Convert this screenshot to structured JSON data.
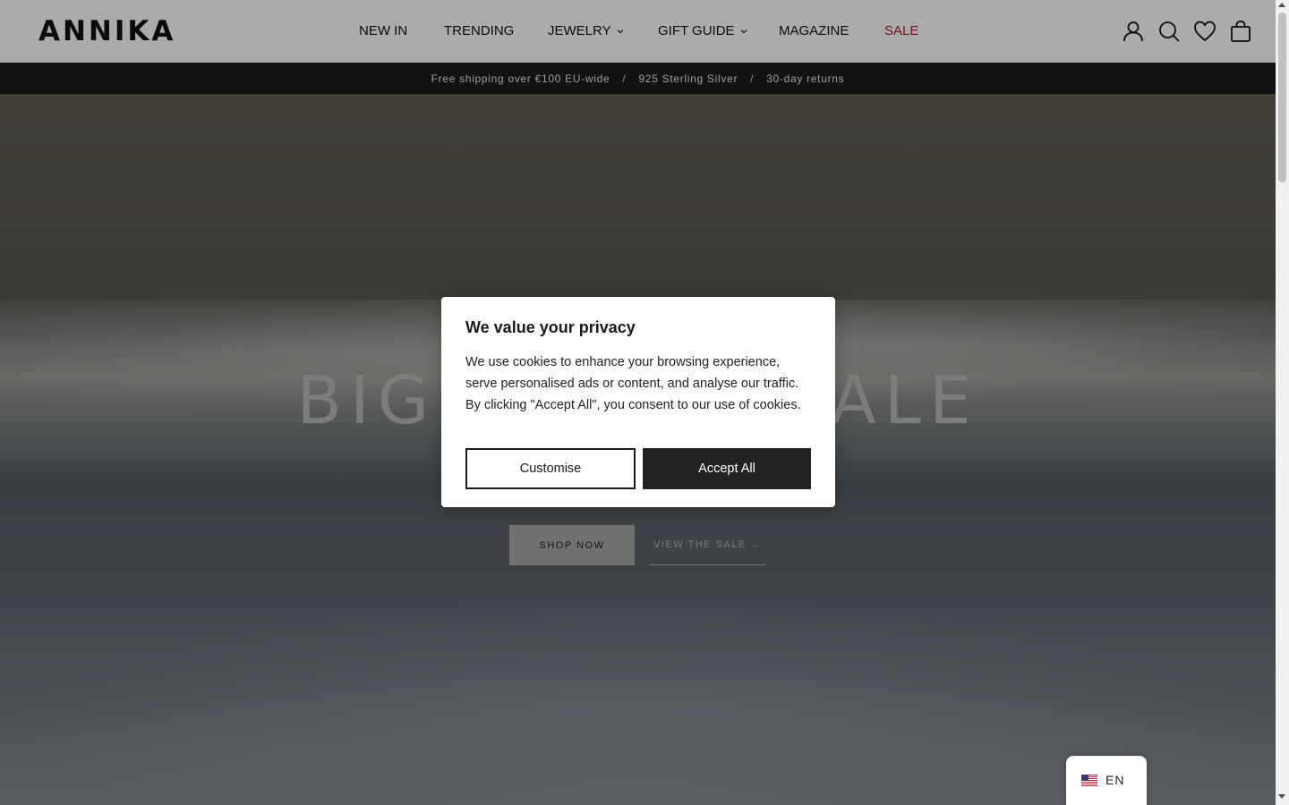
{
  "header": {
    "logo": "ANNIKA",
    "nav": [
      {
        "label": "NEW IN",
        "has_dropdown": false
      },
      {
        "label": "TRENDING",
        "has_dropdown": false
      },
      {
        "label": "JEWELRY",
        "has_dropdown": true
      },
      {
        "label": "GIFT GUIDE",
        "has_dropdown": true
      },
      {
        "label": "MAGAZINE",
        "has_dropdown": false
      },
      {
        "label": "SALE",
        "has_dropdown": false,
        "color": "#a8202b"
      }
    ],
    "icons": [
      "account-icon",
      "search-icon",
      "heart-icon",
      "bag-icon"
    ]
  },
  "announcement": {
    "items": [
      "Free shipping over €100 EU-wide",
      "925 Sterling Silver",
      "30-day returns"
    ],
    "separator": "/"
  },
  "hero": {
    "title_left": "BIG",
    "title_right": "ALE",
    "shop_button": "SHOP NOW",
    "sale_link": "VIEW THE SALE →"
  },
  "cookie_modal": {
    "title": "We value your privacy",
    "text": "We use cookies to enhance your browsing experience, serve personalised ads or content, and analyse our traffic. By clicking \"Accept All\", you consent to our use of cookies.",
    "customise_label": "Customise",
    "accept_label": "Accept All"
  },
  "language": {
    "label": "EN",
    "flag": "us-flag-icon"
  },
  "colors": {
    "announce_bg": "#1b1b1b",
    "sale": "#a8202b",
    "accept_bg": "#222222"
  }
}
